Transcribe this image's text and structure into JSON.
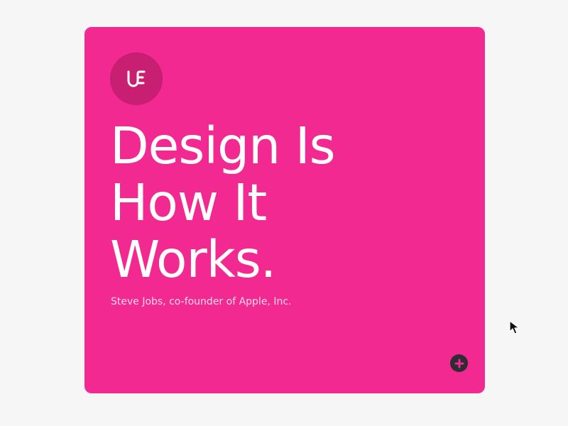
{
  "card": {
    "background": "#f22990",
    "headline_lines": [
      "Design Is",
      "How It",
      "Works."
    ],
    "attribution": "Steve Jobs, co-founder of Apple, Inc."
  },
  "logo": {
    "icon": "uf-monogram-icon",
    "badge_color": "#c91f73"
  },
  "actions": {
    "plus_icon": "plus-icon",
    "plus_color": "#2d2d33"
  },
  "pointer": {
    "icon": "mouse-pointer-icon"
  }
}
